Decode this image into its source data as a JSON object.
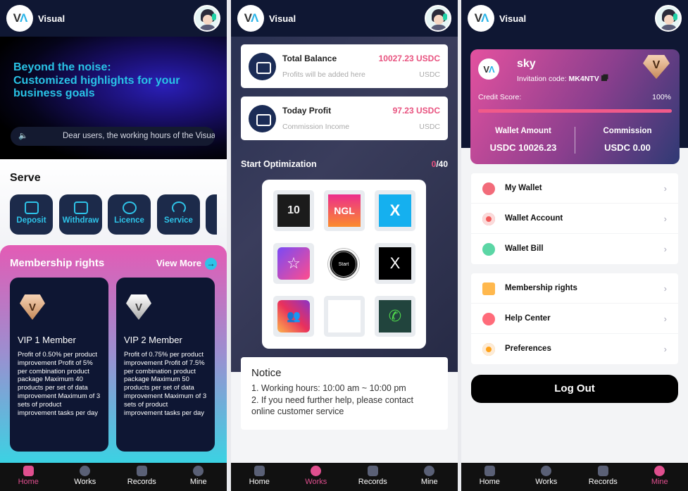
{
  "app": {
    "brand": "Visual",
    "logo_letters": "VA"
  },
  "nav": [
    {
      "label": "Home",
      "icon": "home-icon"
    },
    {
      "label": "Works",
      "icon": "play-icon"
    },
    {
      "label": "Records",
      "icon": "records-icon"
    },
    {
      "label": "Mine",
      "icon": "user-icon"
    }
  ],
  "home": {
    "banner": {
      "line1": "Beyond the noise:",
      "line2": "Customized highlights for your",
      "line3": "business goals"
    },
    "notice": "Dear users, the working hours of the Visual",
    "serve_title": "Serve",
    "services": [
      {
        "label": "Deposit",
        "icon": "deposit-icon"
      },
      {
        "label": "Withdraw",
        "icon": "withdraw-icon"
      },
      {
        "label": "Licence",
        "icon": "licence-icon"
      },
      {
        "label": "Service",
        "icon": "headset-icon"
      }
    ],
    "membership": {
      "title": "Membership rights",
      "view_more": "View More",
      "cards": [
        {
          "name": "VIP 1 Member",
          "badge": "bronze",
          "desc": "Profit of 0.50% per product improvement Profit of 5% per combination product package Maximum 40 products per set of data improvement Maximum of 3 sets of product improvement tasks per day"
        },
        {
          "name": "VIP 2 Member",
          "badge": "silver",
          "desc": "Profit of 0.75% per product improvement Profit of 7.5% per combination product package Maximum 50 products per set of data improvement Maximum of 3 sets of product improvement tasks per day"
        }
      ]
    }
  },
  "works": {
    "total_balance": {
      "title": "Total Balance",
      "subtitle": "Profits will be added here",
      "value": "10027.23 USDC",
      "unit": "USDC"
    },
    "today_profit": {
      "title": "Today Profit",
      "subtitle": "Commission Income",
      "value": "97.23 USDC",
      "unit": "USDC"
    },
    "start_title": "Start Optimization",
    "done": "0",
    "total": "/40",
    "start_label": "Start",
    "apps": [
      {
        "name": "tiktok-10-icon",
        "text": "10"
      },
      {
        "name": "ngl-icon",
        "text": "NGL"
      },
      {
        "name": "x-app-icon",
        "text": "X"
      },
      {
        "name": "starmaker-icon",
        "text": "☆"
      },
      {
        "name": "x-twitter-icon",
        "text": "X"
      },
      {
        "name": "group-app-icon",
        "text": "👥"
      },
      {
        "name": "blank-app-icon",
        "text": ""
      },
      {
        "name": "whatsapp-icon",
        "text": "✆"
      }
    ],
    "notice": {
      "title": "Notice",
      "line1": "1. Working hours: 10:00 am ~ 10:00 pm",
      "line2": "2. If you need further help, please contact online customer service"
    }
  },
  "mine": {
    "username": "sky",
    "invitation_label": "Invitation code: ",
    "invitation_code": "MK4NTV",
    "credit_label": "Credit Score:",
    "credit_value": "100%",
    "credit_percent": 100,
    "wallet_label": "Wallet Amount",
    "wallet_value": "USDC 10026.23",
    "commission_label": "Commission",
    "commission_value": "USDC 0.00",
    "menu1": [
      {
        "label": "My Wallet",
        "color": "#f26b7a"
      },
      {
        "label": "Wallet Account",
        "color": "#f25a5a"
      },
      {
        "label": "Wallet Bill",
        "color": "#5bd6a5"
      }
    ],
    "menu2": [
      {
        "label": "Membership rights",
        "color": "#ffb84d"
      },
      {
        "label": "Help Center",
        "color": "#ff6b7a"
      },
      {
        "label": "Preferences",
        "color": "#ffa21a"
      }
    ],
    "logout": "Log Out"
  },
  "colors": {
    "accent": "#e8527f",
    "cyan": "#2ec3e8",
    "navy": "#0f1733"
  }
}
